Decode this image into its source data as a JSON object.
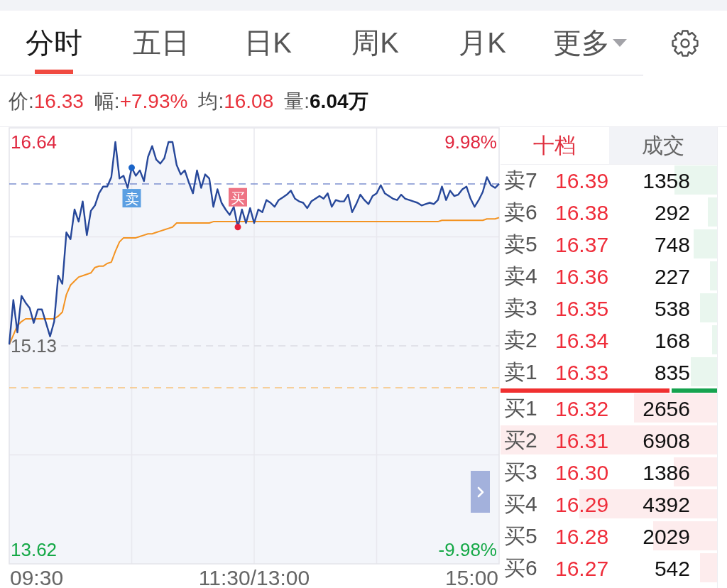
{
  "tabs": [
    {
      "label": "分时",
      "selected": true,
      "dropdown": false
    },
    {
      "label": "五日",
      "selected": false,
      "dropdown": false
    },
    {
      "label": "日K",
      "selected": false,
      "dropdown": false
    },
    {
      "label": "周K",
      "selected": false,
      "dropdown": false
    },
    {
      "label": "月K",
      "selected": false,
      "dropdown": false
    },
    {
      "label": "更多",
      "selected": false,
      "dropdown": true
    }
  ],
  "quote": [
    {
      "label": "价:",
      "value": "16.33",
      "highlight": true
    },
    {
      "label": "幅:",
      "value": "+7.93%",
      "highlight": true
    },
    {
      "label": "均:",
      "value": "16.08",
      "highlight": true
    },
    {
      "label": "量:",
      "value": "6.04万",
      "highlight": false
    }
  ],
  "chart": {
    "pct_labels": [
      "9.98%",
      "-9.98%"
    ],
    "time_labels": [
      "09:30",
      "11:30/13:00",
      "15:00"
    ],
    "chart_data": {
      "type": "line",
      "grid": true,
      "categories": [
        null,
        null,
        null,
        null,
        null,
        null,
        null,
        null,
        null,
        null,
        null,
        null,
        null,
        null,
        null,
        null,
        null,
        null,
        null,
        null,
        null,
        null,
        null,
        null,
        null,
        null,
        null,
        null,
        null,
        null,
        null,
        null,
        null,
        null,
        null,
        null,
        null,
        null,
        null,
        null,
        null,
        null,
        null,
        null,
        null,
        null,
        null,
        null,
        null,
        null,
        null,
        null,
        null,
        null,
        null,
        null,
        null,
        null,
        null,
        null,
        null,
        null,
        null,
        null,
        null,
        null,
        null,
        null,
        null,
        null,
        null,
        null,
        null,
        null,
        null,
        null,
        null,
        null,
        null,
        null,
        null,
        null,
        null,
        null,
        null,
        null,
        null,
        null,
        null,
        null,
        null,
        null,
        null,
        null,
        null,
        null,
        null,
        null,
        null,
        null,
        null,
        null,
        null,
        null,
        null,
        null,
        null,
        null,
        null,
        null,
        null,
        null,
        null,
        null,
        null,
        null,
        null,
        null,
        null,
        null,
        null
      ],
      "series": [
        {
          "color": "#27489a",
          "values": [
            15.14,
            15.47,
            15.23,
            15.5,
            15.45,
            15.41,
            15.3,
            15.4,
            15.4,
            15.3,
            15.2,
            15.31,
            15.65,
            15.59,
            15.97,
            15.92,
            16.14,
            16.05,
            16.2,
            15.95,
            16.13,
            16.17,
            16.26,
            16.31,
            16.31,
            16.38,
            16.64,
            16.37,
            16.39,
            16.3,
            16.45,
            16.39,
            16.43,
            16.35,
            16.53,
            16.61,
            16.51,
            16.48,
            16.52,
            16.64,
            16.64,
            16.47,
            16.4,
            16.43,
            16.34,
            16.26,
            16.43,
            16.3,
            16.4,
            16.37,
            16.16,
            16.29,
            16.19,
            16.14,
            16.1,
            16.16,
            16.01,
            16.14,
            16.04,
            16.15,
            16.04,
            16.14,
            16.12,
            16.21,
            16.19,
            16.16,
            16.21,
            16.23,
            16.25,
            16.28,
            16.22,
            16.2,
            16.19,
            16.15,
            16.2,
            16.22,
            16.24,
            16.22,
            16.26,
            16.16,
            16.21,
            16.2,
            16.2,
            16.25,
            16.12,
            16.18,
            16.25,
            16.21,
            16.18,
            16.24,
            16.26,
            16.32,
            16.26,
            16.24,
            16.22,
            16.21,
            16.25,
            16.22,
            16.21,
            16.2,
            16.19,
            16.17,
            16.18,
            16.19,
            16.18,
            16.21,
            16.31,
            16.21,
            16.28,
            16.24,
            16.25,
            16.29,
            16.31,
            16.22,
            16.16,
            16.21,
            16.27,
            16.38,
            16.32,
            16.3,
            16.33
          ]
        },
        {
          "color": "#f39322",
          "values": [
            15.14,
            15.21,
            15.28,
            15.31,
            15.33,
            15.33,
            15.33,
            15.33,
            15.33,
            15.33,
            15.33,
            15.33,
            15.35,
            15.38,
            15.51,
            15.58,
            15.61,
            15.64,
            15.65,
            15.66,
            15.67,
            15.71,
            15.72,
            15.72,
            15.74,
            15.75,
            15.83,
            15.9,
            15.93,
            15.93,
            15.93,
            15.93,
            15.94,
            15.95,
            15.96,
            15.96,
            15.97,
            15.98,
            15.99,
            16.0,
            16.01,
            16.04,
            16.04,
            16.04,
            16.04,
            16.04,
            16.04,
            16.04,
            16.04,
            16.04,
            16.05,
            16.05,
            16.05,
            16.05,
            16.05,
            16.05,
            16.05,
            16.05,
            16.05,
            16.05,
            16.05,
            16.05,
            16.05,
            16.05,
            16.05,
            16.05,
            16.05,
            16.05,
            16.05,
            16.05,
            16.05,
            16.05,
            16.05,
            16.05,
            16.05,
            16.05,
            16.05,
            16.05,
            16.05,
            16.05,
            16.05,
            16.05,
            16.05,
            16.05,
            16.05,
            16.05,
            16.05,
            16.05,
            16.05,
            16.05,
            16.05,
            16.05,
            16.05,
            16.05,
            16.05,
            16.05,
            16.05,
            16.05,
            16.05,
            16.05,
            16.05,
            16.05,
            16.05,
            16.05,
            16.05,
            16.05,
            16.06,
            16.06,
            16.06,
            16.06,
            16.06,
            16.06,
            16.06,
            16.06,
            16.06,
            16.06,
            16.06,
            16.07,
            16.07,
            16.07,
            16.08
          ]
        }
      ],
      "ylim": [
        13.515,
        16.745
      ],
      "yticks": [
        {
          "value": 16.64,
          "label": "16.64"
        },
        {
          "value": 15.13,
          "label": "15.13"
        },
        {
          "value": 13.62,
          "label": "13.62"
        }
      ],
      "ref_lines": [
        {
          "axis": "y",
          "value": 16.33,
          "color": "#7d90cf"
        },
        {
          "axis": "y",
          "value": 15.13,
          "color": "#dcdce3"
        },
        {
          "axis": "y",
          "value": 14.82,
          "color": "#f8c27c"
        }
      ],
      "annotations": [
        {
          "y": 16.45,
          "text": "卖"
        },
        {
          "y": 16.01,
          "text": "买"
        }
      ]
    }
  },
  "order_book": {
    "tabs": [
      {
        "label": "十档",
        "selected": true
      },
      {
        "label": "成交",
        "selected": false
      }
    ],
    "asks": [
      {
        "label": "卖7",
        "price": "16.39",
        "volume": "1358",
        "level": 0.197
      },
      {
        "label": "卖6",
        "price": "16.38",
        "volume": "292",
        "level": 0.042
      },
      {
        "label": "卖5",
        "price": "16.37",
        "volume": "748",
        "level": 0.108
      },
      {
        "label": "卖4",
        "price": "16.36",
        "volume": "227",
        "level": 0.033
      },
      {
        "label": "卖3",
        "price": "16.35",
        "volume": "538",
        "level": 0.078
      },
      {
        "label": "卖2",
        "price": "16.34",
        "volume": "168",
        "level": 0.024
      },
      {
        "label": "卖1",
        "price": "16.33",
        "volume": "835",
        "level": 0.121
      }
    ],
    "ratio": {
      "level": 0.79
    },
    "bids": [
      {
        "label": "买1",
        "price": "16.32",
        "volume": "2656",
        "level": 0.384
      },
      {
        "label": "买2",
        "price": "16.31",
        "volume": "6908",
        "level": 1
      },
      {
        "label": "买3",
        "price": "16.30",
        "volume": "1386",
        "level": 0.201
      },
      {
        "label": "买4",
        "price": "16.29",
        "volume": "4392",
        "level": 0.636
      },
      {
        "label": "买5",
        "price": "16.28",
        "volume": "2029",
        "level": 0.294
      },
      {
        "label": "买6",
        "price": "16.27",
        "volume": "542",
        "level": 0.078
      }
    ]
  }
}
